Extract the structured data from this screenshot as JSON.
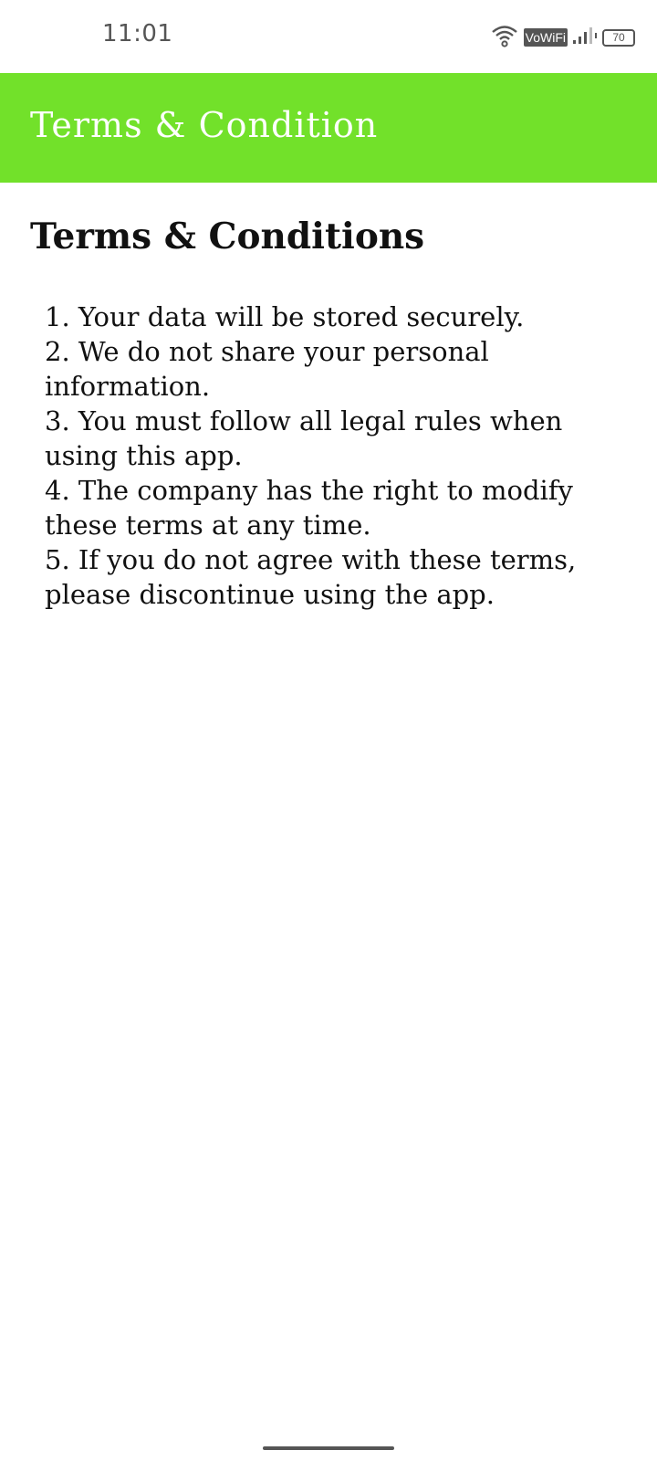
{
  "status_bar": {
    "time": "11:01",
    "network_badge": "VoWiFi",
    "battery_level": "70",
    "icons": [
      "wifi-icon",
      "signal-icon",
      "battery-icon"
    ]
  },
  "app_bar": {
    "title": "Terms & Condition",
    "background_color": "#72e12a"
  },
  "main": {
    "heading": "Terms & Conditions",
    "terms": [
      "1. Your data will be stored securely.",
      "2. We do not share your personal information.",
      "3. You must follow all legal rules when using this app.",
      "4. The company has the right to modify these terms at any time.",
      "5. If you do not agree with these terms, please discontinue using the app."
    ]
  }
}
